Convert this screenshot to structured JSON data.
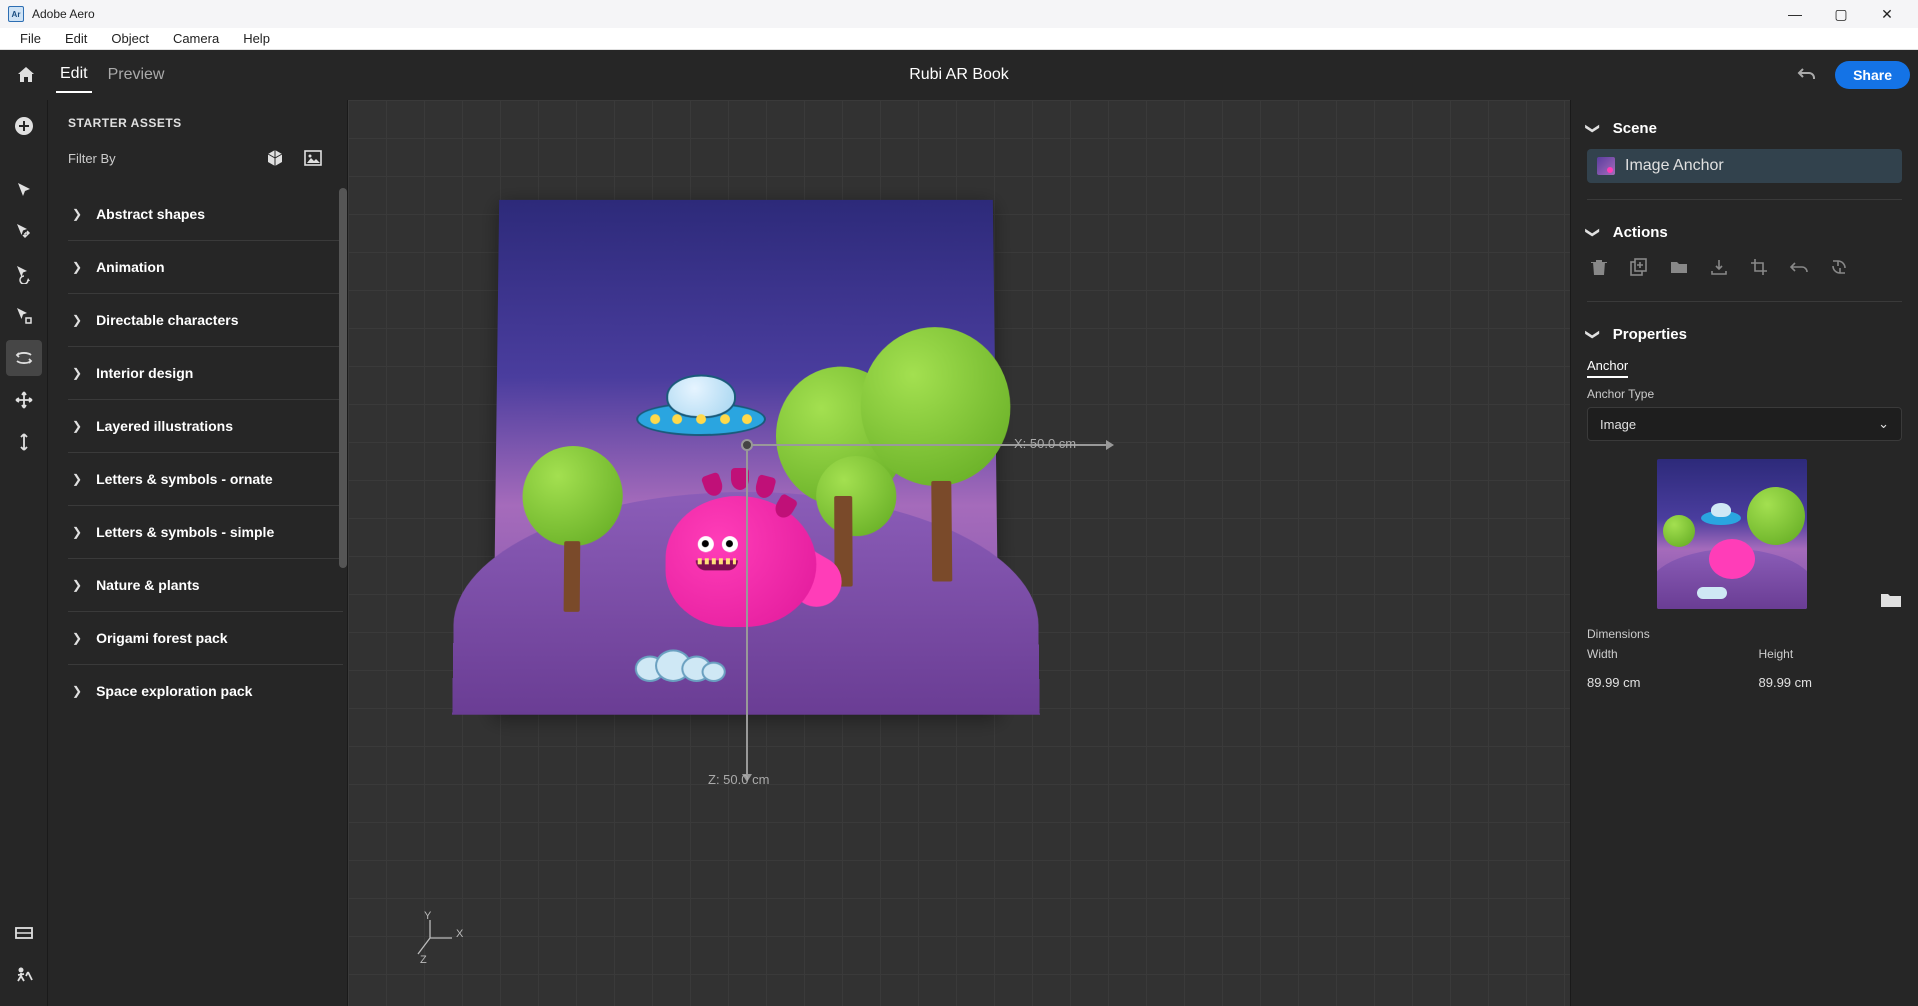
{
  "app": {
    "name": "Adobe Aero",
    "icon_text": "Ar"
  },
  "window_controls": {
    "minimize": "—",
    "maximize": "▢",
    "close": "✕"
  },
  "menubar": [
    "File",
    "Edit",
    "Object",
    "Camera",
    "Help"
  ],
  "topbar": {
    "modes": {
      "edit": "Edit",
      "preview": "Preview",
      "active": "edit"
    },
    "document_title": "Rubi AR Book",
    "share_label": "Share"
  },
  "tool_labels": {
    "add": "add-icon",
    "select": "select-icon",
    "move": "move-icon",
    "rotate": "rotate-icon",
    "pivot": "pivot-icon",
    "look": "look-around-icon",
    "pan": "pan-icon",
    "zoom": "zoom-icon",
    "surface": "surface-icon",
    "behaviors": "behaviors-icon"
  },
  "assets": {
    "heading": "STARTER ASSETS",
    "filter_label": "Filter By",
    "categories": [
      "Abstract shapes",
      "Animation",
      "Directable characters",
      "Interior design",
      "Layered illustrations",
      "Letters & symbols - ornate",
      "Letters & symbols - simple",
      "Nature & plants",
      "Origami forest pack",
      "Space exploration pack"
    ]
  },
  "canvas": {
    "x_axis_label": "X:  50.0 cm",
    "z_axis_label": "Z:  50.0 cm",
    "mini_axis": {
      "x": "X",
      "y": "Y",
      "z": "Z"
    }
  },
  "right": {
    "scene": {
      "title": "Scene",
      "item": "Image Anchor"
    },
    "actions": {
      "title": "Actions"
    },
    "properties": {
      "title": "Properties",
      "tab": "Anchor",
      "anchor_type_label": "Anchor Type",
      "anchor_type_value": "Image",
      "dimensions_label": "Dimensions",
      "width_label": "Width",
      "height_label": "Height",
      "width_value": "89.99 cm",
      "height_value": "89.99 cm"
    }
  }
}
